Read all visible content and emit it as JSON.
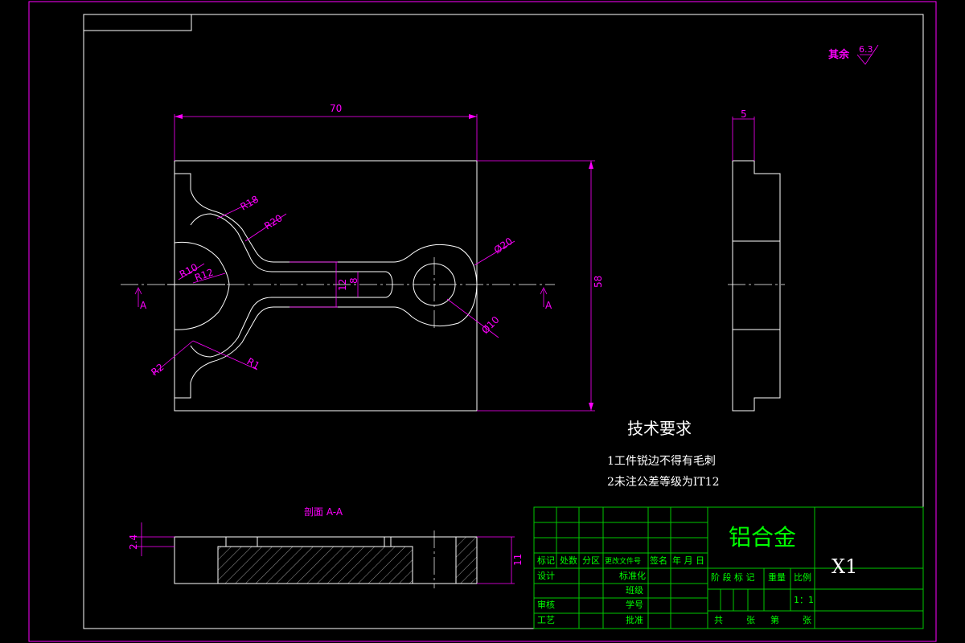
{
  "drawing": {
    "roughness_label": "其余",
    "roughness_value": "6.3",
    "dims": {
      "length": "70",
      "height": "58",
      "thickness": "5",
      "r18": "R18",
      "r20": "R20",
      "r10": "R10",
      "r12": "R12",
      "r2": "R2",
      "r1": "R1",
      "slot_outer": "12",
      "slot_inner": "8",
      "dia20": "Ø20",
      "dia10": "Ø10",
      "depth": "2.4",
      "sect_height": "11"
    },
    "section_marks": {
      "left": "A",
      "right": "A"
    },
    "section_title": "剖面 A-A",
    "tech_req": {
      "title": "技术要求",
      "line1": "1工件锐边不得有毛刺",
      "line2": "2未注公差等级为IT12"
    }
  },
  "title_block": {
    "material": "铝合金",
    "drawing_no": "X1",
    "row_headers": [
      "标记",
      "处数",
      "分区",
      "更改文件号",
      "签名",
      "年 月 日"
    ],
    "design": "设计",
    "standardize": "标准化",
    "review": "审核",
    "process": "工艺",
    "class": "班级",
    "student_no": "学号",
    "approve": "批准",
    "stage_label": "阶 段 标 记",
    "weight_label": "重量",
    "scale_label": "比例",
    "scale": "1：1",
    "sheets_total": "共",
    "sheets_unit": "张",
    "sheet_no": "第",
    "sheet_unit2": "张"
  }
}
